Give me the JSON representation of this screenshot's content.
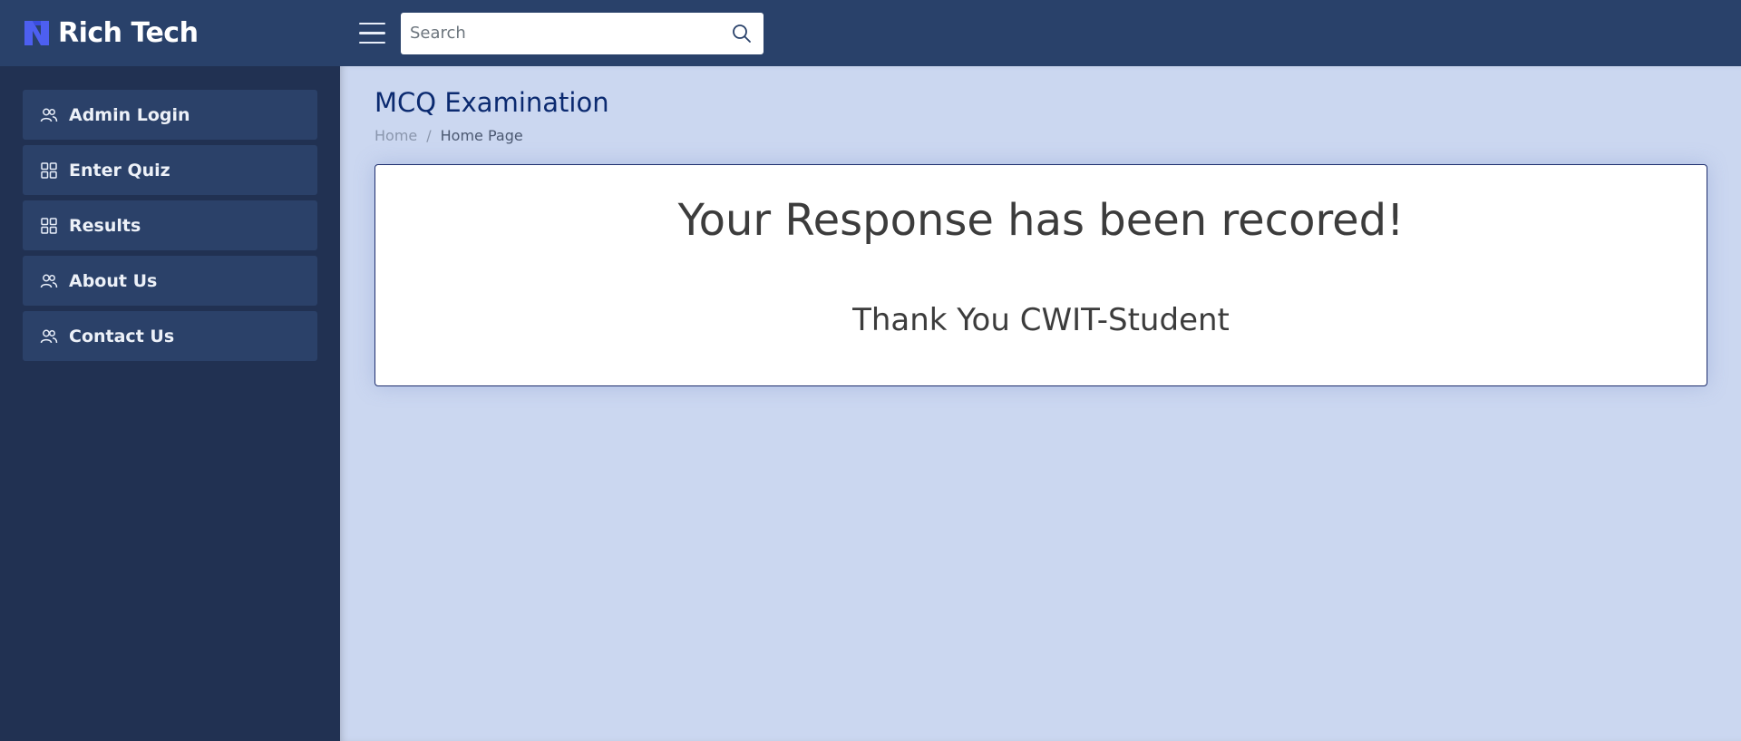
{
  "header": {
    "brand_name": "Rich Tech",
    "brand_logo_icon": "rich-tech-logo-icon",
    "menu_icon": "hamburger-menu-icon",
    "search": {
      "placeholder": "Search",
      "value": "",
      "icon": "search-icon"
    }
  },
  "sidebar": {
    "items": [
      {
        "label": "Admin Login",
        "icon": "users-icon"
      },
      {
        "label": "Enter Quiz",
        "icon": "grid-icon"
      },
      {
        "label": "Results",
        "icon": "grid-icon"
      },
      {
        "label": "About Us",
        "icon": "users-icon"
      },
      {
        "label": "Contact Us",
        "icon": "users-icon"
      }
    ]
  },
  "main": {
    "page_title": "MCQ Examination",
    "breadcrumb": {
      "home": "Home",
      "separator": "/",
      "current": "Home Page"
    },
    "card": {
      "heading": "Your Response has been recored!",
      "subheading": "Thank You CWIT-Student"
    }
  },
  "colors": {
    "header_bg": "#29416a",
    "sidebar_bg": "#213152",
    "sidebar_item_bg": "#2b4169",
    "main_bg": "#cbd7f0",
    "title_color": "#0b2a70",
    "card_border": "#1f2f6e",
    "logo_accent": "#4d5ff0"
  }
}
